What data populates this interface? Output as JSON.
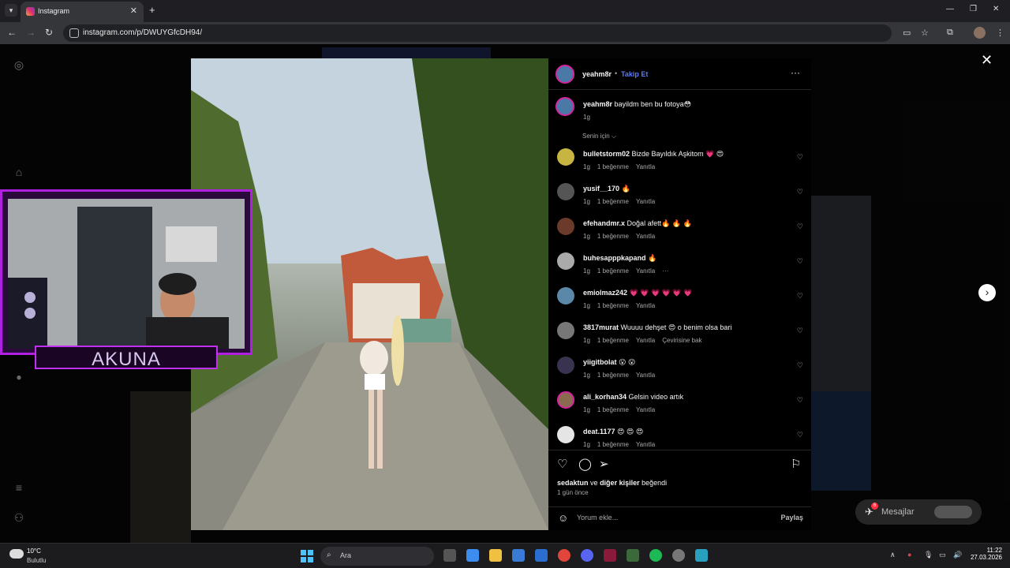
{
  "browser": {
    "tab_title": "Instagram",
    "url": "instagram.com/p/DWUYGfcDH94/"
  },
  "post": {
    "author": "yeahm8r",
    "follow_label": "Takip Et",
    "caption": "bayildm ben bu fotoya😳",
    "caption_time": "1g",
    "sort_label": "Senin için",
    "comments": [
      {
        "user": "bulletstorm02",
        "text": "Bizde Bayıldık Aşkitom 💗 😍",
        "time": "1g",
        "likes": "1 beğenme",
        "reply": "Yanıtla",
        "extra": ""
      },
      {
        "user": "yusif__170",
        "text": "🔥",
        "time": "1g",
        "likes": "1 beğenme",
        "reply": "Yanıtla",
        "extra": ""
      },
      {
        "user": "efehandmr.x",
        "text": "Doğal afett🔥 🔥 🔥",
        "time": "1g",
        "likes": "1 beğenme",
        "reply": "Yanıtla",
        "extra": ""
      },
      {
        "user": "buhesapppkapand",
        "text": "🔥",
        "time": "1g",
        "likes": "1 beğenme",
        "reply": "Yanıtla",
        "extra": "···"
      },
      {
        "user": "emiolmaz242",
        "text": "💗 💗 💗 💗 💗 💗",
        "time": "1g",
        "likes": "1 beğenme",
        "reply": "Yanıtla",
        "extra": ""
      },
      {
        "user": "3817murat",
        "text": "Wuuuu dehşet 😍 o benim olsa bari",
        "time": "1g",
        "likes": "1 beğenme",
        "reply": "Yanıtla",
        "extra": "Çevirisine bak"
      },
      {
        "user": "yiigitbolat",
        "text": "😮 😮",
        "time": "1g",
        "likes": "1 beğenme",
        "reply": "Yanıtla",
        "extra": ""
      },
      {
        "user": "ali_korhan34",
        "text": "Gelsin video artık",
        "time": "1g",
        "likes": "1 beğenme",
        "reply": "Yanıtla",
        "extra": ""
      },
      {
        "user": "deat.1177",
        "text": "😍 😍 😍",
        "time": "1g",
        "likes": "1 beğenme",
        "reply": "Yanıtla",
        "extra": ""
      }
    ],
    "likes_user": "sedaktun",
    "likes_mid": "ve",
    "likes_others": "diğer kişiler",
    "likes_suffix": "beğendi",
    "posted_ago": "1 gün önce",
    "comment_placeholder": "Yorum ekle...",
    "share_label": "Paylaş"
  },
  "messages": {
    "label": "Mesajlar",
    "badge": "6"
  },
  "stream": {
    "cam_label": "AKUNA"
  },
  "taskbar": {
    "temp": "10°C",
    "weather": "Bulutlu",
    "search_label": "Ara",
    "time": "11:22",
    "date": "27.03.2026"
  },
  "colors": {
    "accent": "#5b7bff",
    "cam_border": "#b020e0",
    "ig_bg": "#000000"
  }
}
